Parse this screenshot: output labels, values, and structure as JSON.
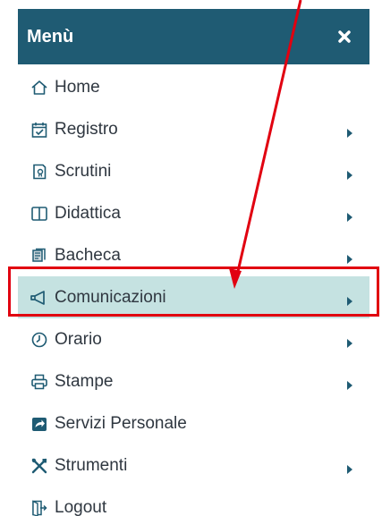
{
  "menu": {
    "title": "Menù",
    "items": [
      {
        "label": "Home",
        "icon": "home-icon",
        "has_submenu": false,
        "active": false
      },
      {
        "label": "Registro",
        "icon": "calendar-check-icon",
        "has_submenu": true,
        "active": false
      },
      {
        "label": "Scrutini",
        "icon": "document-icon",
        "has_submenu": true,
        "active": false
      },
      {
        "label": "Didattica",
        "icon": "book-icon",
        "has_submenu": true,
        "active": false
      },
      {
        "label": "Bacheca",
        "icon": "bulletin-board-icon",
        "has_submenu": true,
        "active": false
      },
      {
        "label": "Comunicazioni",
        "icon": "megaphone-icon",
        "has_submenu": true,
        "active": true
      },
      {
        "label": "Orario",
        "icon": "clock-icon",
        "has_submenu": true,
        "active": false
      },
      {
        "label": "Stampe",
        "icon": "printer-icon",
        "has_submenu": true,
        "active": false
      },
      {
        "label": "Servizi Personale",
        "icon": "share-icon",
        "has_submenu": false,
        "active": false
      },
      {
        "label": "Strumenti",
        "icon": "tools-icon",
        "has_submenu": true,
        "active": false
      },
      {
        "label": "Logout",
        "icon": "logout-icon",
        "has_submenu": false,
        "active": false
      }
    ]
  },
  "colors": {
    "header_bg": "#1f5b73",
    "active_bg": "#c5e2e1",
    "icon_color": "#1f5b73",
    "text_color": "#2f3740",
    "annotation": "#e10010"
  }
}
